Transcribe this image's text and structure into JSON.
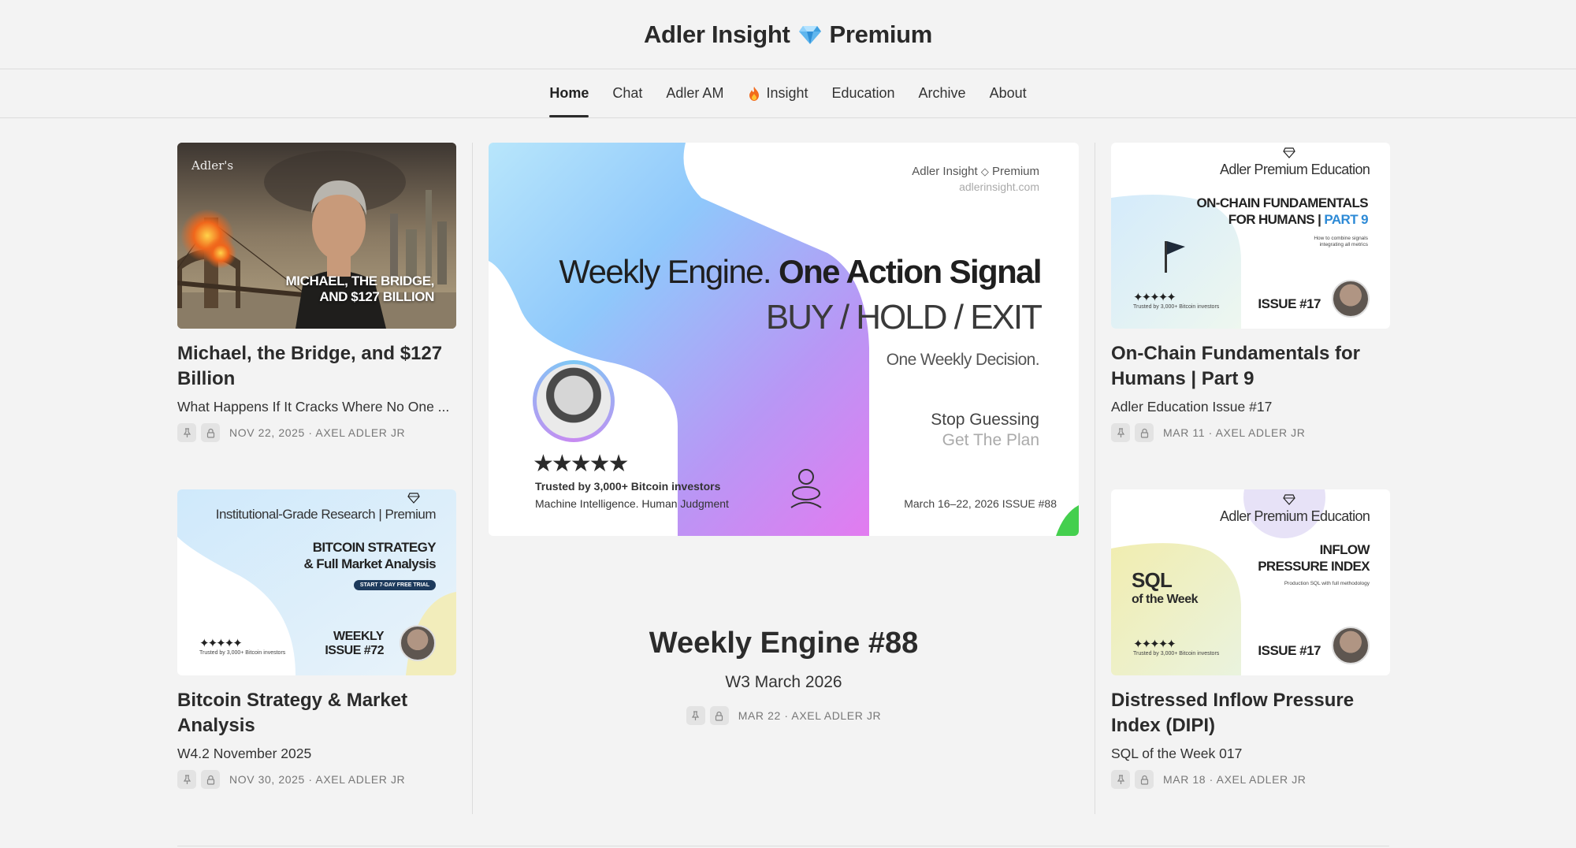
{
  "site": {
    "title_left": "Adler Insight",
    "title_right": "Premium",
    "icon": "diamond-icon"
  },
  "nav": [
    {
      "label": "Home",
      "active": true
    },
    {
      "label": "Chat"
    },
    {
      "label": "Adler AM"
    },
    {
      "label": "Insight",
      "icon": "flame-icon"
    },
    {
      "label": "Education"
    },
    {
      "label": "Archive"
    },
    {
      "label": "About"
    }
  ],
  "cards": {
    "left1": {
      "title": "Michael, the Bridge, and $127 Billion",
      "subtitle": "What Happens If It Cracks Where No One ...",
      "meta": "NOV 22, 2025 · AXEL ADLER JR",
      "thumb": {
        "brand": "Adler's",
        "line1": "MICHAEL, THE BRIDGE,",
        "line2": "AND $127 BILLION"
      }
    },
    "left2": {
      "title": "Bitcoin Strategy & Market Analysis",
      "subtitle": "W4.2 November 2025",
      "meta": "NOV 30, 2025 · AXEL ADLER JR",
      "thumb": {
        "header": "Institutional-Grade Research | Premium",
        "line1": "BITCOIN STRATEGY",
        "line2": "& Full Market Analysis",
        "badge": "START 7-DAY FREE TRIAL",
        "trust": "Trusted by 3,000+ Bitcoin investors",
        "issue1": "WEEKLY",
        "issue2": "ISSUE #72"
      }
    },
    "right1": {
      "title": "On-Chain Fundamentals for Humans | Part 9",
      "subtitle": "Adler Education Issue #17",
      "meta": "MAR 11 · AXEL ADLER JR",
      "thumb": {
        "header": "Adler Premium Education",
        "line1": "ON-CHAIN FUNDAMENTALS",
        "line2a": "FOR HUMANS |",
        "line2b": "PART 9",
        "small1": "How to combine signals",
        "small2": "integrating all metrics",
        "trust": "Trusted by 3,000+ Bitcoin investors",
        "issue": "ISSUE #17"
      }
    },
    "right2": {
      "title": "Distressed Inflow Pressure Index (DIPI)",
      "subtitle": "SQL of the Week 017",
      "meta": "MAR 18 · AXEL ADLER JR",
      "thumb": {
        "header": "Adler Premium Education",
        "sql1": "SQL",
        "sql2": "of the Week",
        "line1": "INFLOW",
        "line2": "PRESSURE INDEX",
        "small": "Production SQL with full methodology",
        "trust": "Trusted by 3,000+ Bitcoin investors",
        "issue": "ISSUE #17"
      }
    }
  },
  "feature": {
    "title": "Weekly Engine #88",
    "subtitle": "W3 March 2026",
    "meta": "MAR 22 · AXEL ADLER JR",
    "thumb": {
      "brand": "Adler Insight",
      "brand2": "Premium",
      "url": "adlerinsight.com",
      "headline_a": "Weekly Engine.",
      "headline_b": "One Action Signal",
      "signal": "BUY / HOLD / EXIT",
      "decision": "One Weekly Decision.",
      "stop": "Stop Guessing",
      "plan": "Get The Plan",
      "trust": "Trusted by 3,000+ Bitcoin investors",
      "tagline": "Machine Intelligence. Human Judgment",
      "dates": "March 16–22, 2026  ISSUE #88"
    }
  }
}
